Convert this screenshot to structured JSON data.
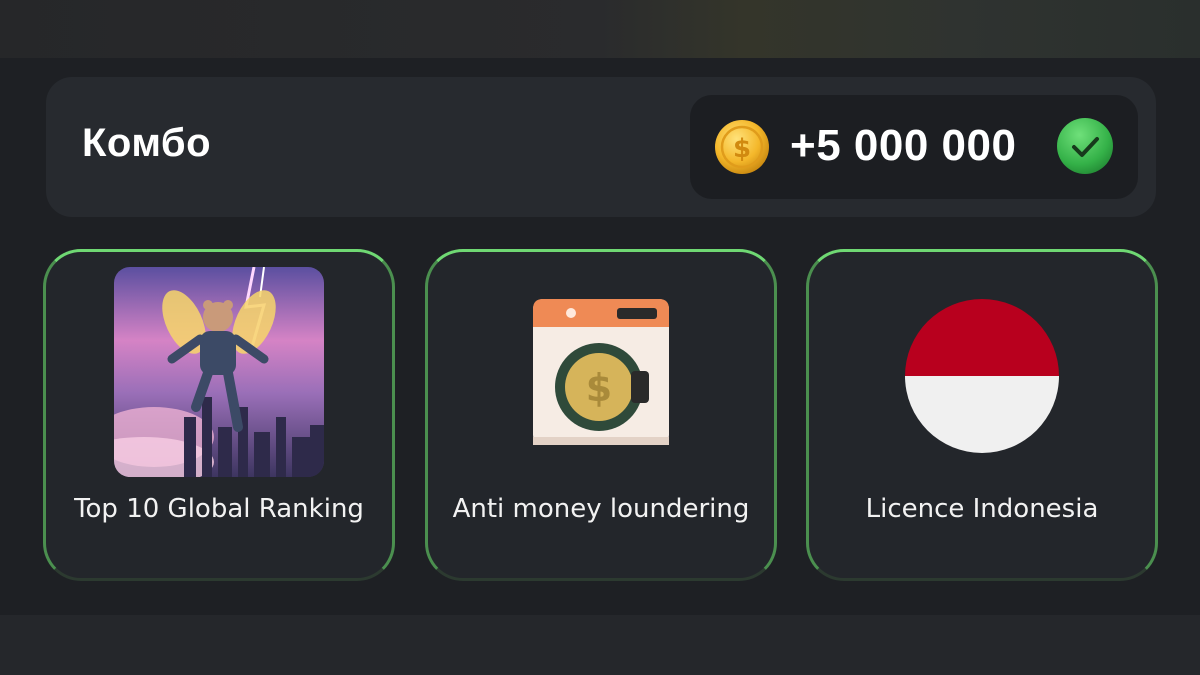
{
  "combo": {
    "title": "Комбо",
    "reward": "+5 000 000",
    "coin_icon": "gold-dollar-coin-icon",
    "status_icon": "green-check-icon",
    "status_color": "#3cbf4e"
  },
  "cards": [
    {
      "label": "Top 10 Global Ranking",
      "icon": "hamster-astronaut-image"
    },
    {
      "label": "Anti money loundering",
      "icon": "washing-machine-coin-icon"
    },
    {
      "label": "Licence Indonesia",
      "icon": "indonesia-flag-icon"
    }
  ],
  "colors": {
    "card_border": "#6fd873",
    "background": "#1e2024",
    "flag_red": "#b8001e"
  }
}
